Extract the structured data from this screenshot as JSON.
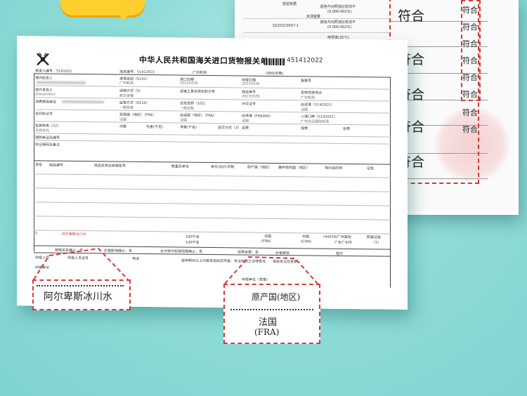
{
  "back_sheet": {
    "lines": [
      "检验依据",
      "颜色与对照液比较浓不",
      "(0.000-002%)",
      "颜色与对照液比较浓不",
      "(0.000-002%)",
      "SZ20210037-1",
      "电导率(25℃)"
    ],
    "side_label": "未测催量",
    "value_labels": [
      "符合",
      "符合",
      "符合",
      "符合",
      "符合"
    ],
    "small_labels": [
      "符合",
      "符合",
      "符合",
      "符合",
      "符合",
      "符合",
      "符合",
      "符合"
    ]
  },
  "form": {
    "title": "中华人民共和国海关进口货物报关单",
    "number": "451412022",
    "fields": {
      "pre_entry_no": "预录入编号：5141022",
      "customs_no": "海关编号：51412022",
      "declaring_customs": "广州机场",
      "page": "(页码/页数)",
      "domestic_consignee": "境内收货人",
      "entry_customs": "进境关别（5141）",
      "entry_customs_value": "广州机场",
      "import_date": "进口日期",
      "import_date_value": "20220326",
      "declare_date": "申报日期",
      "declare_date_value": "20220326",
      "record_no": "备案号",
      "overseas_consignor": "境外发货人",
      "overseas_consignor_value": "Glacier(Inc)",
      "transport_mode": "运输方式（5）",
      "transport_mode_value": "航空运输",
      "transport_name": "运输工具名称及航次号",
      "bill_no": "提运单号",
      "bill_no_value": "20220326",
      "storage_place": "货物存放地点",
      "storage_place_value": "广州机场",
      "consumer_unit": "消费使用单位",
      "supervision": "监管方式（0110）",
      "supervision_value": "一般贸易",
      "exemption": "征免性质（101）",
      "exemption_value": "一般征税",
      "license_no": "许可证号",
      "departure_port": "启运港（5142021）",
      "departure_port_value": "法国",
      "contract_no": "合同协议号",
      "trade_country": "贸易国（地区）（FRA）",
      "trade_country_value": "法国",
      "origin_country_field": "启运国（地区）（FRA）",
      "origin_country_field_value": "法国",
      "transit_port": "经停港（FRA000）",
      "transit_port_value": "法国",
      "entry_port": "入境口岸（5142021）",
      "entry_port_value": "广州白云国际机场",
      "package_type": "包装种类（22）",
      "package_type_value": "天然木托",
      "pieces": "件数",
      "gross_weight": "毛重(千克)",
      "net_weight": "净重(千克)",
      "deal_mode": "成交方式（3）",
      "freight": "运费",
      "insurance": "保费",
      "misc": "杂费",
      "docs": "随附单证及编号",
      "marks": "标记唛码及备注",
      "col_no": "项号",
      "col_code": "商品编号",
      "col_name": "商品名称及规格型号",
      "col_qty": "数量及单位",
      "col_price": "单价/总价/币制",
      "col_origin": "原产国（地区）",
      "col_dest": "最终目的国（地区）",
      "col_domestic": "境内目的地",
      "col_tax": "征免",
      "row_item": "5",
      "row_product": "阿尔卑斯冰川水",
      "row_qty1": "100千克",
      "row_qty2": "100千克",
      "row_origin": "法国",
      "row_origin_code": "(FRA)",
      "row_dest": "中国",
      "row_dest_code": "(CHN)",
      "row_domestic": "(44019)广州其他",
      "row_domestic2": "广东广州市",
      "row_tax": "照章征税",
      "row_tax_code": "(1)",
      "special": "特殊关系确认：否",
      "price_effect": "价格影响确认：否",
      "royalty": "支付特许权使用费确认：否",
      "self_report": "自报自缴：否",
      "declarant": "申报人员",
      "declarant_card": "申报人员证号",
      "phone": "电话",
      "statement": "兹申明对以上内容承担如实申报、依法纳税之法律责任",
      "customs_note": "海关批注及签章",
      "declare_unit": "申报单位",
      "declare_seal": "申报单位（签章）",
      "price_audit": "价格审核",
      "seal": "签印"
    }
  },
  "callouts": {
    "product_name": "阿尔卑斯冰川水",
    "origin_label": "原产国(地区)",
    "origin_country": "法国",
    "origin_code": "(FRA)"
  }
}
